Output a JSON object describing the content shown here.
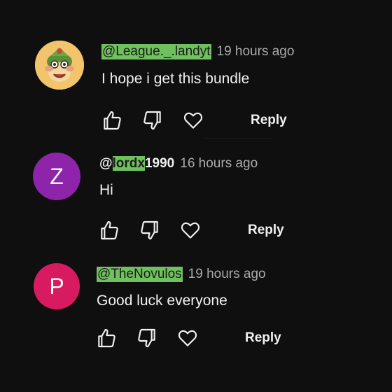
{
  "comments": [
    {
      "author": "@League._.landyt",
      "time": "19 hours ago",
      "text": "I hope i get this bundle",
      "reply_label": "Reply",
      "avatar_type": "image",
      "avatar_color": "#f2c46b"
    },
    {
      "author_prefix": "@",
      "author_highlight": "lordx",
      "author_suffix": "1990",
      "time": "16 hours ago",
      "text": "Hi",
      "reply_label": "Reply",
      "avatar_letter": "Z",
      "avatar_color": "#8e24aa"
    },
    {
      "author": "@TheNovulos",
      "time": "19 hours ago",
      "text": "Good luck everyone",
      "reply_label": "Reply",
      "avatar_letter": "P",
      "avatar_color": "#d81b60"
    }
  ],
  "icons": [
    "like-icon",
    "dislike-icon",
    "heart-icon"
  ],
  "colors": {
    "background": "#0f0f0f",
    "highlight": "#6fc15d",
    "secondary_text": "#aaaaaa",
    "primary_text": "#f1f1f1"
  }
}
